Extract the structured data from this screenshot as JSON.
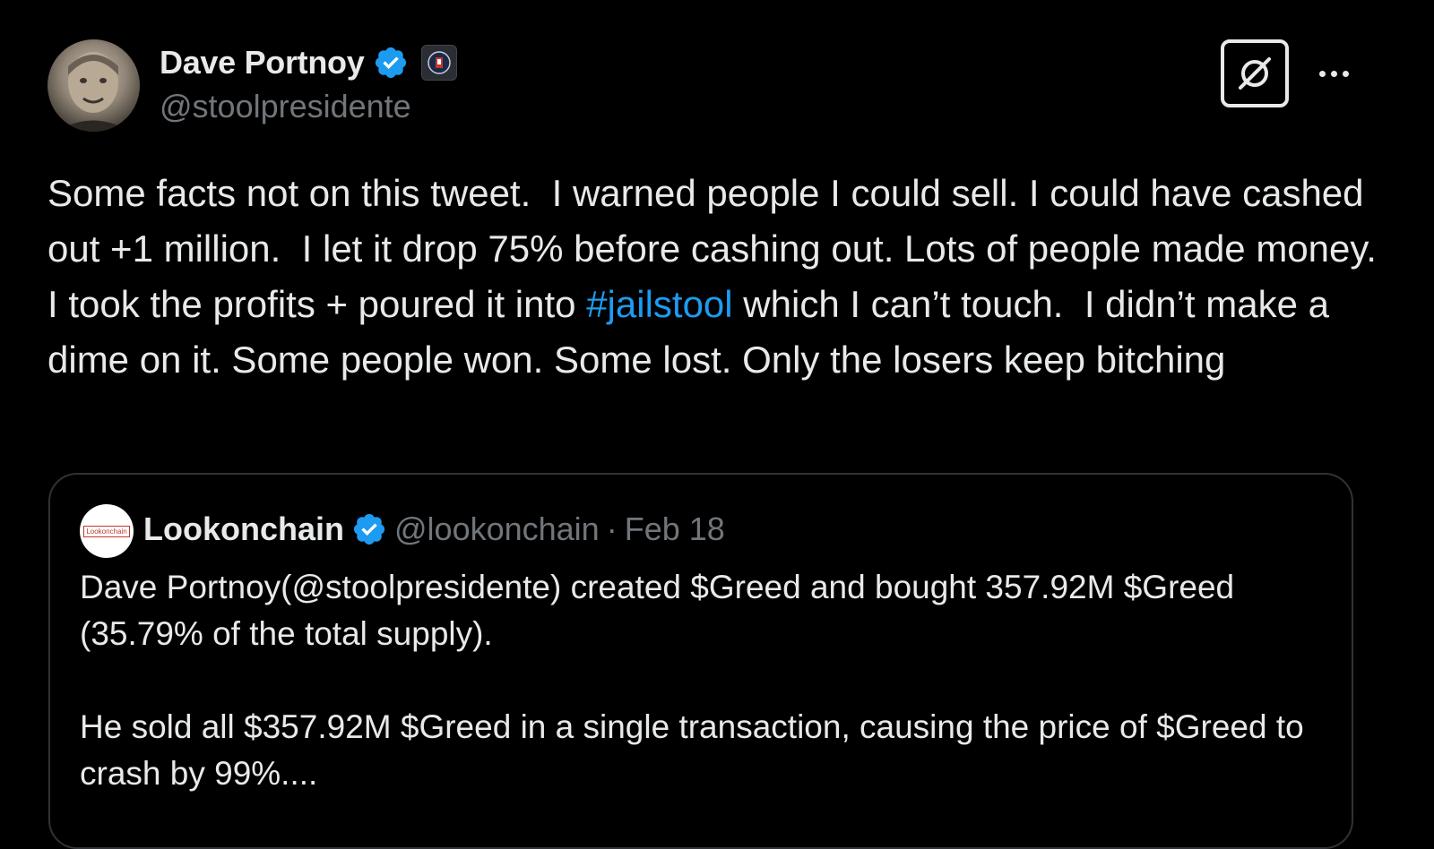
{
  "author": {
    "display_name": "Dave Portnoy",
    "handle": "@stoolpresidente",
    "verified": true,
    "avatar_icon": "profile-photo",
    "affiliate_badge_icon": "barstool-badge-icon"
  },
  "actions": {
    "grok_icon": "grok-icon",
    "more_icon": "more-icon"
  },
  "tweet": {
    "text_before_hashtag": "Some facts not on this tweet.  I warned people I could sell. I could have cashed out +1 million.  I let it drop 75% before cashing out. Lots of people made money. I took the profits + poured it into ",
    "hashtag": "#jailstool",
    "text_after_hashtag": " which I can’t touch.  I didn’t make a dime on it. Some people won. Some lost. Only the losers keep bitching"
  },
  "quoted": {
    "avatar_label": "Lookonchain",
    "display_name": "Lookonchain",
    "handle": "@lookonchain",
    "separator": "·",
    "date": "Feb 18",
    "paragraph1": "Dave Portnoy(@stoolpresidente) created $Greed and bought 357.92M $Greed (35.79% of the total supply).",
    "paragraph2": "He sold all $357.92M $Greed in a single transaction, causing the price of $Greed to crash by 99%...."
  },
  "colors": {
    "background": "#000000",
    "text": "#e7e9ea",
    "secondary": "#71767b",
    "link": "#1d9bf0",
    "verified": "#1d9bf0",
    "border": "#2f3336"
  }
}
